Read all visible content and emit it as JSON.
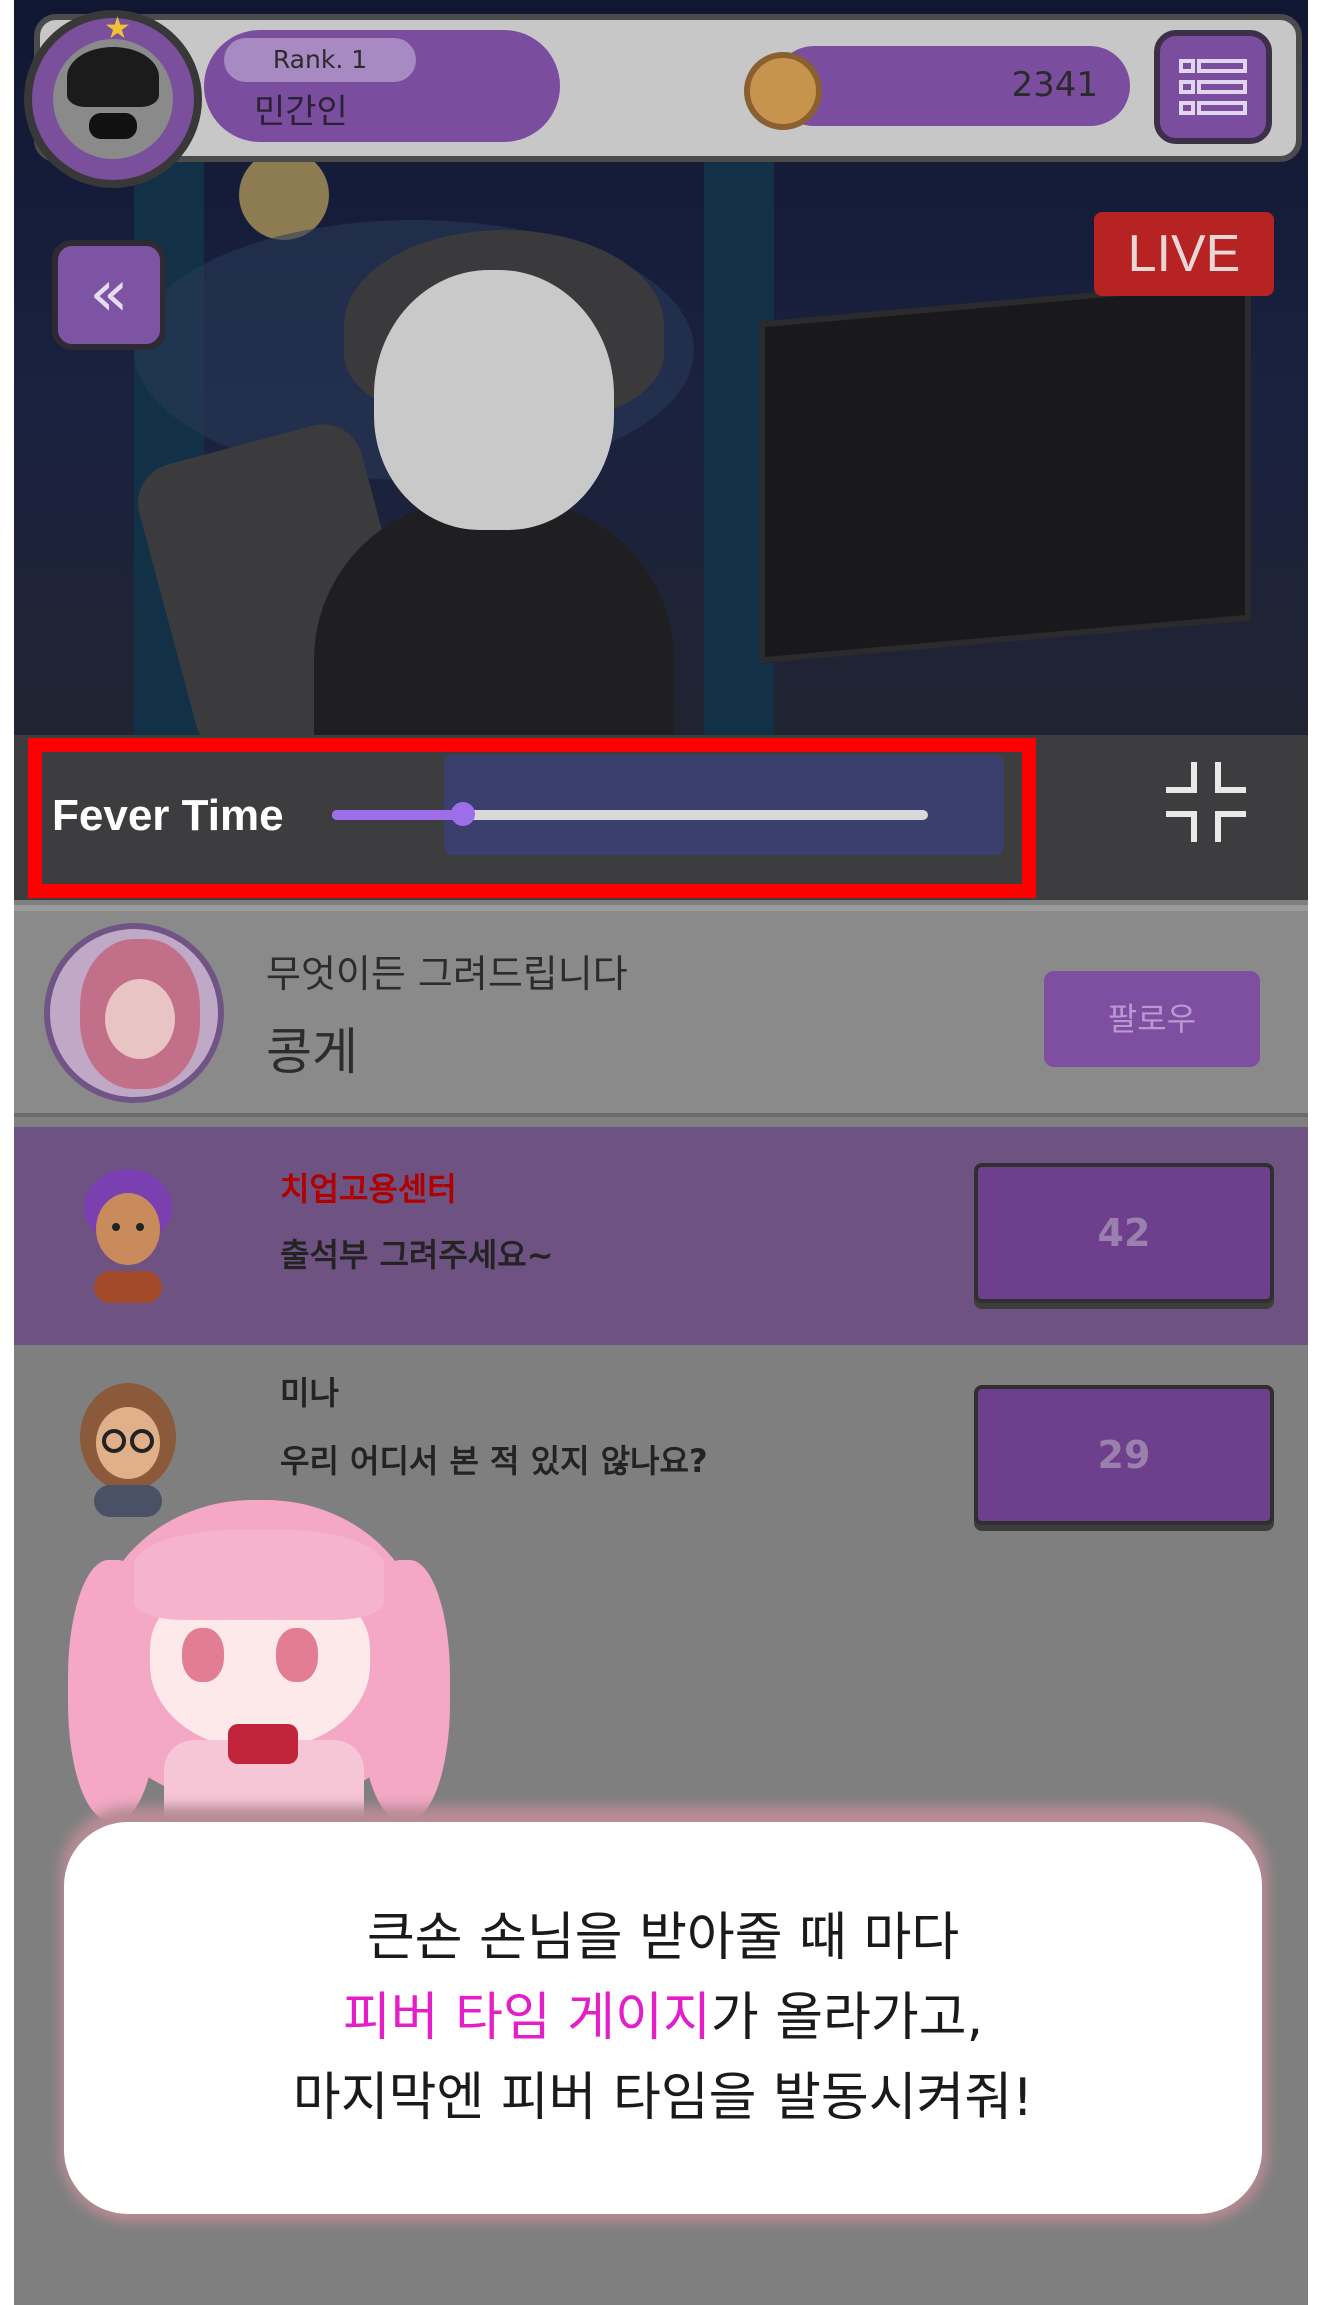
{
  "header": {
    "rank_label": "Rank. 1",
    "username": "민간인",
    "coins": "2341",
    "menu_icon": "list-menu-icon",
    "avatar_icon": "player-avatar",
    "star_icon": "star-icon"
  },
  "stream": {
    "back_icon": "double-chevron-left-icon",
    "back_glyph": "«",
    "live_label": "LIVE",
    "shrink_icon": "collapse-screen-icon"
  },
  "fever": {
    "label": "Fever Time",
    "progress": 0.22,
    "highlight_color": "#ff0000",
    "fill_color": "#9d6ee8"
  },
  "streamer": {
    "subtitle": "무엇이든 그려드립니다",
    "name": "콩게",
    "follow_label": "팔로우"
  },
  "chat": [
    {
      "user": "치업고용센터",
      "message": "출석부 그려주세요~",
      "gift": "42",
      "user_color": "#b00000",
      "highlighted": true
    },
    {
      "user": "미나",
      "message": "우리 어디서 본 적 있지 않나요?",
      "gift": "29",
      "user_color": "#232323",
      "highlighted": false
    }
  ],
  "dialog": {
    "line1": "큰손 손님을 받아줄 때 마다",
    "line2_highlight": "피버 타임 게이지",
    "line2_rest": "가 올라가고,",
    "line3": "마지막엔 피버 타임을 발동시켜줘!",
    "highlight_color": "#e41ec8"
  },
  "colors": {
    "accent_purple": "#7b4d9e",
    "live_red": "#b72222",
    "panel_gray": "#7f7f7f"
  }
}
